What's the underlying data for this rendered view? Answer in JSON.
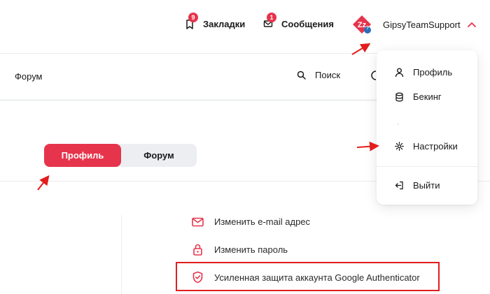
{
  "header": {
    "bookmarks": {
      "label": "Закладки",
      "badge": "9",
      "icon": "bookmark-icon"
    },
    "messages": {
      "label": "Сообщения",
      "badge": "1",
      "icon": "envelope-icon"
    },
    "user": {
      "name": "GipsyTeamSupport",
      "avatar_text": "?",
      "expand_icon": "chevron-up-icon"
    }
  },
  "nav": {
    "forum": "Форум",
    "search": "Поиск"
  },
  "tabs": [
    {
      "label": "Профиль",
      "active": true
    },
    {
      "label": "Форум",
      "active": false
    }
  ],
  "security": {
    "items": [
      {
        "label": "Изменить e-mail адрес",
        "icon": "mail-icon"
      },
      {
        "label": "Изменить пароль",
        "icon": "lock-icon"
      },
      {
        "label": "Усиленная защита аккаунта Google Authenticator",
        "icon": "shield-check-icon"
      }
    ]
  },
  "dropdown": {
    "items": [
      {
        "label": "Профиль",
        "icon": "user-icon"
      },
      {
        "label": "Бекинг",
        "icon": "coins-icon"
      },
      {
        "label": "Настройки",
        "icon": "gear-icon"
      },
      {
        "label": "Выйти",
        "icon": "logout-icon"
      }
    ]
  },
  "colors": {
    "accent": "#e6344c",
    "annotation": "#e31d1d",
    "tab_bg": "#eceef1"
  }
}
